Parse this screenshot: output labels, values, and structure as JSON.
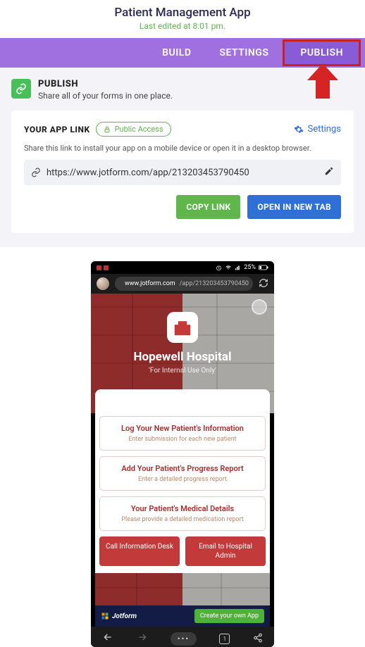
{
  "header": {
    "title": "Patient Management App",
    "last_edited": "Last edited at 8:01 pm."
  },
  "tabs": {
    "build": "BUILD",
    "settings": "SETTINGS",
    "publish": "PUBLISH"
  },
  "publish_section": {
    "title": "PUBLISH",
    "subtitle": "Share all of your forms in one place."
  },
  "card": {
    "heading": "YOUR APP LINK",
    "chip": "Public Access",
    "settings": "Settings",
    "note": "Share this link to install your app on a mobile device or open it in a desktop browser.",
    "url": "https://www.jotform.com/app/213203453790450",
    "copy_btn": "COPY LINK",
    "open_btn": "OPEN IN NEW TAB"
  },
  "phone": {
    "status": {
      "battery": "25%"
    },
    "address": {
      "domain": "www.jotform.com",
      "path": "/app/213203453790450"
    },
    "hero": {
      "title": "Hopewell Hospital",
      "subtitle": "'For Internal Use Only'"
    },
    "options": [
      {
        "title": "Log Your New Patient's Information",
        "sub": "Enter submission for each new patient"
      },
      {
        "title": "Add Your Patient's Progress Report",
        "sub": "Enter a detailed progress report"
      },
      {
        "title": "Your Patient's Medical Details",
        "sub": "Please provide a detailed medication report"
      }
    ],
    "pills": {
      "call": "Call Information Desk",
      "email": "Email to Hospital Admin"
    },
    "promo": {
      "brand": "Jotform",
      "cta": "Create your own App"
    },
    "tab_count": "1"
  }
}
